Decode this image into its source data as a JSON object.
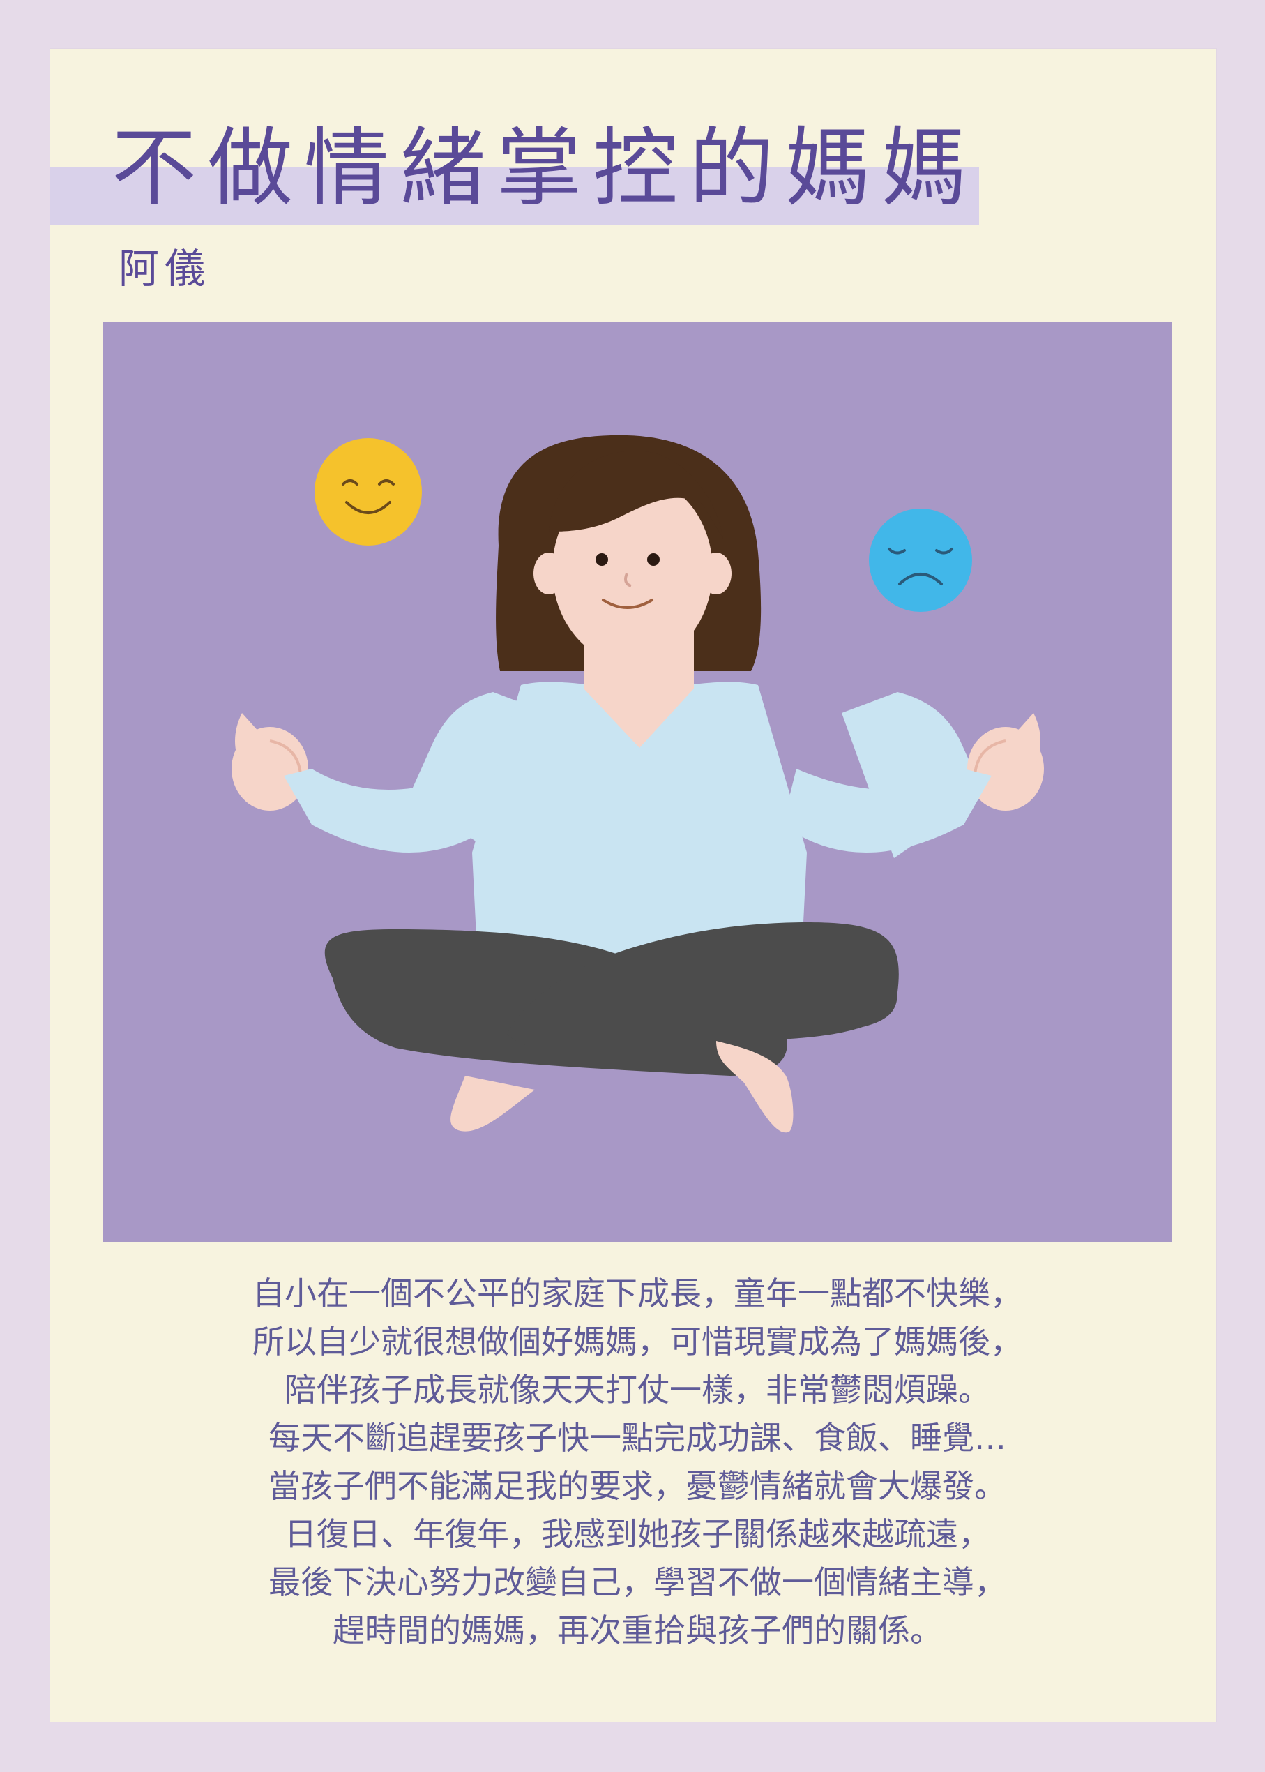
{
  "title": "不做情緒掌控的媽媽",
  "author": "阿儀",
  "body_lines": [
    "自小在一個不公平的家庭下成長，童年一點都不快樂，",
    "所以自少就很想做個好媽媽，可惜現實成為了媽媽後，",
    "陪伴孩子成長就像天天打仗一樣，非常鬱悶煩躁。",
    "每天不斷追趕要孩子快一點完成功課、食飯、睡覺…",
    "當孩子們不能滿足我的要求，憂鬱情緒就會大爆發。",
    "日復日、年復年，我感到她孩子關係越來越疏遠，",
    "最後下決心努力改變自己，學習不做一個情緒主導，",
    "趕時間的媽媽，再次重拾與孩子們的關係。"
  ],
  "illustration": {
    "happy_face_icon": "smiley-face-icon",
    "sad_face_icon": "sad-face-icon"
  },
  "colors": {
    "page_background": "#e6dbe9",
    "card_background": "#f7f3df",
    "title_band": "#d9d1ea",
    "title_text": "#5a4a98",
    "body_text": "#5f5b98",
    "illustration_background": "#a898c6",
    "happy_face": "#f5c22c",
    "sad_face": "#41b7e9",
    "hair": "#4b2f1a",
    "skin": "#f6d5c9",
    "shirt": "#c9e4f2",
    "pants": "#4c4c4c"
  }
}
